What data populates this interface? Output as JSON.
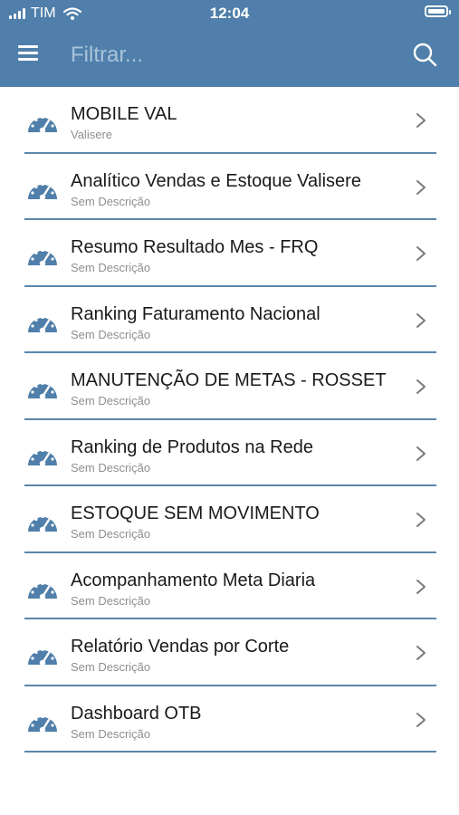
{
  "status_bar": {
    "carrier": "TIM",
    "time": "12:04"
  },
  "header": {
    "menu_icon": "hamburger-menu-icon",
    "search_placeholder": "Filtrar...",
    "search_value": "",
    "search_icon": "search-icon",
    "color": "#4f7faa"
  },
  "colors": {
    "accent": "#4f7faa",
    "divider": "#5a86ad",
    "title": "#1a1a1a",
    "subtitle": "#8e8e8e"
  },
  "list": {
    "items": [
      {
        "icon": "dashboard-gauge-icon",
        "title": "MOBILE VAL",
        "subtitle": "Valisere"
      },
      {
        "icon": "dashboard-gauge-icon",
        "title": "Analítico Vendas e Estoque Valisere",
        "subtitle": "Sem Descrição"
      },
      {
        "icon": "dashboard-gauge-icon",
        "title": "Resumo Resultado Mes - FRQ",
        "subtitle": "Sem Descrição"
      },
      {
        "icon": "dashboard-gauge-icon",
        "title": "Ranking Faturamento Nacional",
        "subtitle": "Sem Descrição"
      },
      {
        "icon": "dashboard-gauge-icon",
        "title": "MANUTENÇÃO DE METAS - ROSSET",
        "subtitle": "Sem Descrição"
      },
      {
        "icon": "dashboard-gauge-icon",
        "title": "Ranking de Produtos na Rede",
        "subtitle": "Sem Descrição"
      },
      {
        "icon": "dashboard-gauge-icon",
        "title": "ESTOQUE SEM MOVIMENTO",
        "subtitle": "Sem Descrição"
      },
      {
        "icon": "dashboard-gauge-icon",
        "title": "Acompanhamento Meta Diaria",
        "subtitle": "Sem Descrição"
      },
      {
        "icon": "dashboard-gauge-icon",
        "title": "Relatório Vendas por Corte",
        "subtitle": "Sem Descrição"
      },
      {
        "icon": "dashboard-gauge-icon",
        "title": "Dashboard OTB",
        "subtitle": "Sem Descrição"
      }
    ]
  }
}
